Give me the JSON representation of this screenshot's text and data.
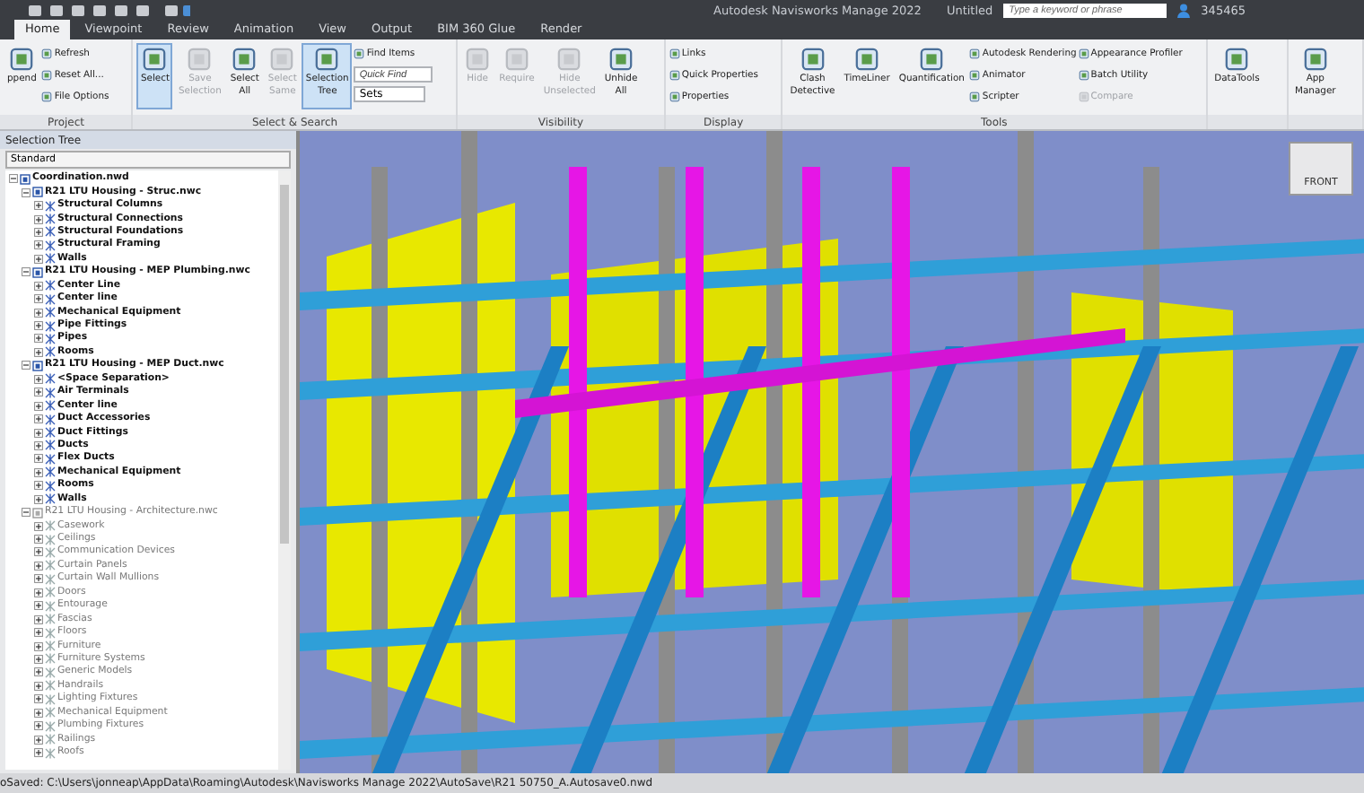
{
  "title_bar": {
    "title": "Autodesk Navisworks Manage 2022",
    "document": "Untitled",
    "search": {
      "placeholder": "Type a keyword or phrase"
    },
    "user": "345465"
  },
  "tabs": [
    {
      "label": "Home",
      "selected": true
    },
    {
      "label": "Viewpoint",
      "selected": false
    },
    {
      "label": "Review",
      "selected": false
    },
    {
      "label": "Animation",
      "selected": false
    },
    {
      "label": "View",
      "selected": false
    },
    {
      "label": "Output",
      "selected": false
    },
    {
      "label": "BIM 360 Glue",
      "selected": false
    },
    {
      "label": "Render",
      "selected": false
    }
  ],
  "ribbon": [
    {
      "label": "Project",
      "items": [
        {
          "kind": "large",
          "label": "ppend",
          "active": false,
          "disabled": false
        },
        {
          "kind": "stack",
          "items": [
            {
              "kind": "small",
              "label": "Refresh",
              "disabled": false
            },
            {
              "kind": "small",
              "label": "Reset All...",
              "disabled": false
            },
            {
              "kind": "small",
              "label": "File Options",
              "disabled": false
            }
          ]
        }
      ]
    },
    {
      "label": "Select & Search",
      "items": [
        {
          "kind": "large",
          "label": "Select",
          "active": true,
          "disabled": false
        },
        {
          "kind": "large",
          "label": "Save Selection",
          "active": false,
          "disabled": true
        },
        {
          "kind": "large",
          "label": "Select All",
          "active": false,
          "disabled": false
        },
        {
          "kind": "large",
          "label": "Select Same",
          "active": false,
          "disabled": true
        },
        {
          "kind": "large",
          "label": "Selection Tree",
          "active": true,
          "disabled": false
        },
        {
          "kind": "stack",
          "items": [
            {
              "kind": "small",
              "label": "Find Items",
              "disabled": false
            },
            {
              "kind": "field",
              "placeholder": "Quick Find",
              "disabled": false
            },
            {
              "kind": "dropdown",
              "label": "Sets",
              "disabled": false
            }
          ]
        }
      ]
    },
    {
      "label": "Visibility",
      "items": [
        {
          "kind": "large",
          "label": "Hide",
          "active": false,
          "disabled": true
        },
        {
          "kind": "large",
          "label": "Require",
          "active": false,
          "disabled": true
        },
        {
          "kind": "large",
          "label": "Hide Unselected",
          "active": false,
          "disabled": true
        },
        {
          "kind": "large",
          "label": "Unhide All",
          "active": false,
          "disabled": false
        }
      ]
    },
    {
      "label": "Display",
      "items": [
        {
          "kind": "stack",
          "items": [
            {
              "kind": "small",
              "label": "Links",
              "disabled": false
            },
            {
              "kind": "small",
              "label": "Quick Properties",
              "disabled": false
            },
            {
              "kind": "small",
              "label": "Properties",
              "disabled": false
            }
          ]
        }
      ]
    },
    {
      "label": "Tools",
      "items": [
        {
          "kind": "large",
          "label": "Clash Detective",
          "active": false,
          "disabled": false
        },
        {
          "kind": "large",
          "label": "TimeLiner",
          "active": false,
          "disabled": false
        },
        {
          "kind": "large",
          "label": "Quantification",
          "active": false,
          "disabled": false
        },
        {
          "kind": "stack",
          "items": [
            {
              "kind": "small",
              "label": "Autodesk Rendering",
              "disabled": false
            },
            {
              "kind": "small",
              "label": "Animator",
              "disabled": false
            },
            {
              "kind": "small",
              "label": "Scripter",
              "disabled": false
            }
          ]
        },
        {
          "kind": "stack",
          "items": [
            {
              "kind": "small",
              "label": "Appearance Profiler",
              "disabled": false
            },
            {
              "kind": "small",
              "label": "Batch Utility",
              "disabled": false
            },
            {
              "kind": "small",
              "label": "Compare",
              "disabled": true
            }
          ]
        }
      ]
    },
    {
      "items": [
        {
          "kind": "large",
          "label": "DataTools",
          "active": false,
          "disabled": false
        }
      ]
    },
    {
      "items": [
        {
          "kind": "large",
          "label": "App Manager",
          "active": false,
          "disabled": false
        }
      ]
    }
  ],
  "selection_tree": {
    "title": "Selection Tree",
    "mode": "Standard",
    "items": [
      {
        "kind": "file",
        "label": "Coordination.nwd",
        "hidden": false,
        "expanded": true,
        "children": [
          {
            "kind": "file",
            "label": "R21 LTU Housing - Struc.nwc",
            "hidden": false,
            "expanded": true,
            "children": [
              {
                "kind": "layer",
                "label": "Structural Columns",
                "hidden": false,
                "expanded": false
              },
              {
                "kind": "layer",
                "label": "Structural Connections",
                "hidden": false,
                "expanded": false
              },
              {
                "kind": "layer",
                "label": "Structural Foundations",
                "hidden": false,
                "expanded": false
              },
              {
                "kind": "layer",
                "label": "Structural Framing",
                "hidden": false,
                "expanded": false
              },
              {
                "kind": "layer",
                "label": "Walls",
                "hidden": false,
                "expanded": false
              }
            ]
          },
          {
            "kind": "file",
            "label": "R21 LTU Housing - MEP Plumbing.nwc",
            "hidden": false,
            "expanded": true,
            "children": [
              {
                "kind": "layer",
                "label": "Center Line",
                "hidden": false,
                "expanded": false
              },
              {
                "kind": "layer",
                "label": "Center line",
                "hidden": false,
                "expanded": false
              },
              {
                "kind": "layer",
                "label": "Mechanical Equipment",
                "hidden": false,
                "expanded": false
              },
              {
                "kind": "layer",
                "label": "Pipe Fittings",
                "hidden": false,
                "expanded": false
              },
              {
                "kind": "layer",
                "label": "Pipes",
                "hidden": false,
                "expanded": false
              },
              {
                "kind": "layer",
                "label": "Rooms",
                "hidden": false,
                "expanded": false
              }
            ]
          },
          {
            "kind": "file",
            "label": "R21 LTU Housing - MEP Duct.nwc",
            "hidden": false,
            "expanded": true,
            "children": [
              {
                "kind": "layer",
                "label": "<Space Separation>",
                "hidden": false,
                "expanded": false
              },
              {
                "kind": "layer",
                "label": "Air Terminals",
                "hidden": false,
                "expanded": false
              },
              {
                "kind": "layer",
                "label": "Center line",
                "hidden": false,
                "expanded": false
              },
              {
                "kind": "layer",
                "label": "Duct Accessories",
                "hidden": false,
                "expanded": false
              },
              {
                "kind": "layer",
                "label": "Duct Fittings",
                "hidden": false,
                "expanded": false
              },
              {
                "kind": "layer",
                "label": "Ducts",
                "hidden": false,
                "expanded": false
              },
              {
                "kind": "layer",
                "label": "Flex Ducts",
                "hidden": false,
                "expanded": false
              },
              {
                "kind": "layer",
                "label": "Mechanical Equipment",
                "hidden": false,
                "expanded": false
              },
              {
                "kind": "layer",
                "label": "Rooms",
                "hidden": false,
                "expanded": false
              },
              {
                "kind": "layer",
                "label": "Walls",
                "hidden": false,
                "expanded": false
              }
            ]
          },
          {
            "kind": "file",
            "label": "R21 LTU Housing - Architecture.nwc",
            "hidden": true,
            "expanded": true,
            "children": [
              {
                "kind": "layer",
                "label": "Casework",
                "hidden": true,
                "expanded": false
              },
              {
                "kind": "layer",
                "label": "Ceilings",
                "hidden": true,
                "expanded": false
              },
              {
                "kind": "layer",
                "label": "Communication Devices",
                "hidden": true,
                "expanded": false
              },
              {
                "kind": "layer",
                "label": "Curtain Panels",
                "hidden": true,
                "expanded": false
              },
              {
                "kind": "layer",
                "label": "Curtain Wall Mullions",
                "hidden": true,
                "expanded": false
              },
              {
                "kind": "layer",
                "label": "Doors",
                "hidden": true,
                "expanded": false
              },
              {
                "kind": "layer",
                "label": "Entourage",
                "hidden": true,
                "expanded": false
              },
              {
                "kind": "layer",
                "label": "Fascias",
                "hidden": true,
                "expanded": false
              },
              {
                "kind": "layer",
                "label": "Floors",
                "hidden": true,
                "expanded": false
              },
              {
                "kind": "layer",
                "label": "Furniture",
                "hidden": true,
                "expanded": false
              },
              {
                "kind": "layer",
                "label": "Furniture Systems",
                "hidden": true,
                "expanded": false
              },
              {
                "kind": "layer",
                "label": "Generic Models",
                "hidden": true,
                "expanded": false
              },
              {
                "kind": "layer",
                "label": "Handrails",
                "hidden": true,
                "expanded": false
              },
              {
                "kind": "layer",
                "label": "Lighting Fixtures",
                "hidden": true,
                "expanded": false
              },
              {
                "kind": "layer",
                "label": "Mechanical Equipment",
                "hidden": true,
                "expanded": false
              },
              {
                "kind": "layer",
                "label": "Plumbing Fixtures",
                "hidden": true,
                "expanded": false
              },
              {
                "kind": "layer",
                "label": "Railings",
                "hidden": true,
                "expanded": false
              },
              {
                "kind": "layer",
                "label": "Roofs",
                "hidden": true,
                "expanded": false
              }
            ]
          }
        ]
      }
    ]
  },
  "viewcube": {
    "label": "FRONT"
  },
  "status_bar": {
    "text": "oSaved: C:\\Users\\jonneap\\AppData\\Roaming\\Autodesk\\Navisworks Manage 2022\\AutoSave\\R21 50750_A.Autosave0.nwd"
  }
}
